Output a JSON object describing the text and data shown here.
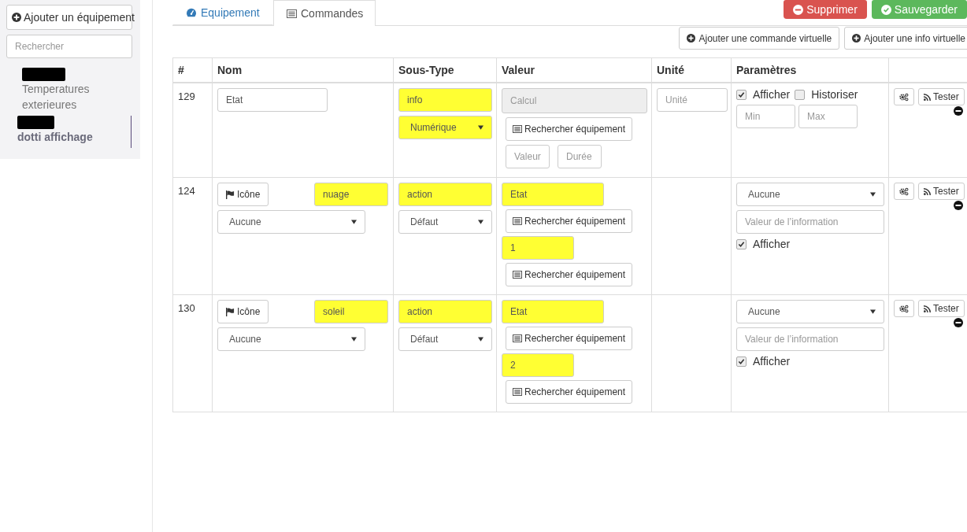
{
  "sidebar": {
    "add_button": "Ajouter un équipement",
    "search": {
      "placeholder": "Rechercher"
    },
    "items": [
      {
        "redacted": true,
        "label": "Temperatures exterieures",
        "selected": false
      },
      {
        "redacted": true,
        "label": "dotti affichage",
        "selected": true
      }
    ]
  },
  "tabs": [
    {
      "label": "Equipement",
      "selected": false
    },
    {
      "label": "Commandes",
      "selected": true
    }
  ],
  "actions": [
    {
      "label": "Supprimer",
      "kind": "danger"
    },
    {
      "label": "Sauvegarder",
      "kind": "success"
    }
  ],
  "add_buttons": [
    "Ajouter une commande virtuelle",
    "Ajouter une info virtuelle"
  ],
  "table": {
    "columns": [
      "#",
      "Nom",
      "Sous-Type",
      "Valeur",
      "Unité",
      "Paramètres"
    ],
    "rows": [
      {
        "kind": "info",
        "id": "129",
        "info_name": "Etat",
        "type": "info",
        "subtype": "Numérique",
        "value_placeholder": "Calcul",
        "search_button": "Rechercher équipement",
        "valeur_placeholder": "Valeur",
        "duree_placeholder": "Durée",
        "unit_placeholder": "Unité",
        "afficher": {
          "label": "Afficher",
          "checked": true
        },
        "historiser": {
          "label": "Historiser",
          "checked": false
        },
        "min_placeholder": "Min",
        "max_placeholder": "Max",
        "tester": "Tester",
        "type_marked": true,
        "subtype_marked": true
      },
      {
        "kind": "action",
        "id": "124",
        "icon_button": "Icône",
        "name": "nuage",
        "generic": "Aucune",
        "type": "action",
        "subtype": "Défaut",
        "value": "Etat",
        "search_button": "Rechercher équipement",
        "value2": "1",
        "search_button2": "Rechercher équipement",
        "param_select": "Aucune",
        "info_placeholder": "Valeur de l’information",
        "afficher": {
          "label": "Afficher",
          "checked": true
        },
        "tester": "Tester",
        "name_marked": true,
        "type_marked": true,
        "value_marked": true,
        "value2_marked": true
      },
      {
        "kind": "action",
        "id": "130",
        "icon_button": "Icône",
        "name": "soleil",
        "generic": "Aucune",
        "type": "action",
        "subtype": "Défaut",
        "value": "Etat",
        "search_button": "Rechercher équipement",
        "value2": "2",
        "search_button2": "Rechercher équipement",
        "param_select": "Aucune",
        "info_placeholder": "Valeur de l’information",
        "afficher": {
          "label": "Afficher",
          "checked": true
        },
        "tester": "Tester",
        "name_marked": true,
        "type_marked": true,
        "value_marked": true,
        "value2_marked": true
      }
    ]
  }
}
